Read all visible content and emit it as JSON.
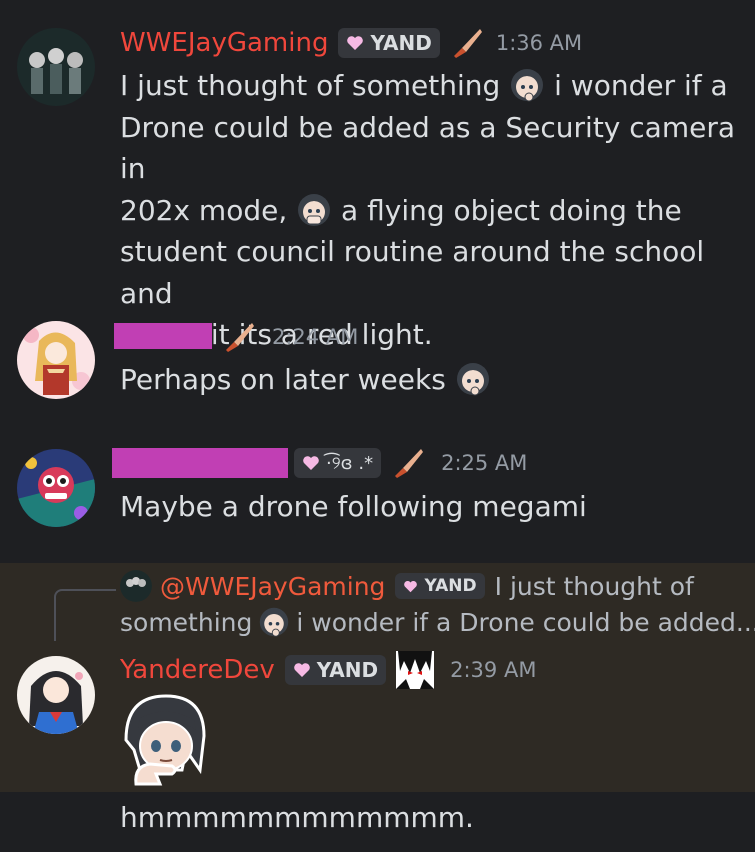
{
  "colors": {
    "background": "#1e1f22",
    "reply_highlight": "#2e2a24",
    "username_red": "#f0473c",
    "redaction": "#c13fb4",
    "timestamp": "#949ba4",
    "text": "#dbdee1"
  },
  "messages": [
    {
      "username": "WWEJayGaming",
      "tag": "YAND",
      "timestamp": "1:36 AM",
      "text_parts": [
        "I just thought of something",
        "i wonder if a",
        "Drone could be added as a Security camera in",
        "202x mode,",
        "a flying object doing the",
        "student council routine around the school and",
        "under it its a red light."
      ],
      "icons": [
        "knife-icon",
        "thinking-anime-emoji",
        "hiding-anime-emoji"
      ]
    },
    {
      "username": "",
      "timestamp": "2:24 AM",
      "text": "Perhaps on later weeks",
      "icons": [
        "knife-icon",
        "thinking-anime-emoji"
      ]
    },
    {
      "username": "",
      "tag": "·͡୨ɞ .*",
      "timestamp": "2:25 AM",
      "text": "Maybe a drone following megami",
      "icons": [
        "knife-icon"
      ]
    },
    {
      "reply": {
        "mention": "@WWEJayGaming",
        "tag": "YAND",
        "line1": "I just thought of",
        "line2_a": "something",
        "line2_b": "i wonder if a Drone could be added..."
      },
      "username": "YandereDev",
      "tag": "YAND",
      "timestamp": "2:39 AM",
      "icons": [
        "anime-face-badge-icon",
        "thinking-anime-sticker"
      ]
    },
    {
      "text": "hmmmmmmmmmmmm."
    }
  ]
}
